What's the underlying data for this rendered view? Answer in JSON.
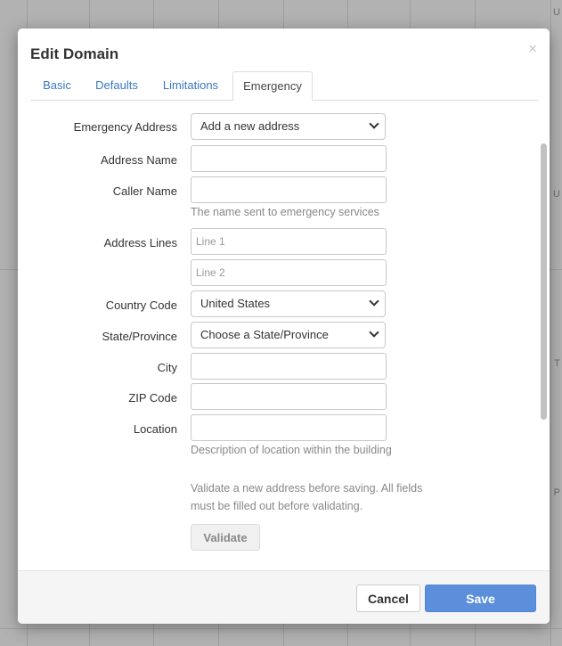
{
  "background": {
    "letters": [
      "U",
      "U",
      "T",
      "P"
    ]
  },
  "modal": {
    "title": "Edit Domain",
    "close_symbol": "×",
    "tabs": [
      {
        "label": "Basic"
      },
      {
        "label": "Defaults"
      },
      {
        "label": "Limitations"
      },
      {
        "label": "Emergency",
        "active": true
      }
    ]
  },
  "form": {
    "emergency_address": {
      "label": "Emergency Address",
      "value": "Add a new address"
    },
    "address_name": {
      "label": "Address Name",
      "value": ""
    },
    "caller_name": {
      "label": "Caller Name",
      "value": "",
      "help": "The name sent to emergency services"
    },
    "address_lines": {
      "label": "Address Lines",
      "line1_placeholder": "Line 1",
      "line2_placeholder": "Line 2"
    },
    "country_code": {
      "label": "Country Code",
      "value": "United States"
    },
    "state": {
      "label": "State/Province",
      "value": "Choose a State/Province"
    },
    "city": {
      "label": "City",
      "value": ""
    },
    "zip": {
      "label": "ZIP Code",
      "value": ""
    },
    "location": {
      "label": "Location",
      "value": "",
      "help": "Description of location within the building"
    },
    "validate_help_1": "Validate a new address before saving. All fields",
    "validate_help_2": "must be filled out before validating.",
    "validate_label": "Validate"
  },
  "footer": {
    "cancel_label": "Cancel",
    "save_label": "Save"
  },
  "colors": {
    "accent": "#5b8fdb",
    "link": "#3a78c2"
  }
}
